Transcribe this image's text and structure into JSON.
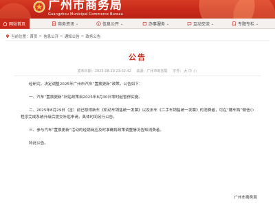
{
  "header": {
    "title": "广州市商务局",
    "subtitle": "Guangzhou Municipal Commerce Bureau"
  },
  "nav": {
    "items": [
      {
        "label": "网站首页",
        "active": true
      },
      {
        "label": "商务资讯"
      },
      {
        "label": "信息公开"
      },
      {
        "label": "办事服务"
      },
      {
        "label": "互动交流"
      },
      {
        "label": "专题专栏"
      }
    ]
  },
  "breadcrumb": {
    "prefix": "当前位置：",
    "items": [
      "首页",
      "信息公开",
      "通知公告",
      "政务公告"
    ],
    "separator": ">"
  },
  "article": {
    "title": "公告",
    "publish_label": "发布日期：",
    "publish_date": "2025-08-29 23:02:42",
    "source_label": "来源：",
    "source": "广州市商务局",
    "font_size_label": "字号：",
    "font_sizes": [
      "大",
      "中",
      "小"
    ],
    "paragraphs": [
      "经研究，决定调整2025年广州市汽车“置换更新”政策，公告如下：",
      "一、汽车“置换更新”补贴政策自2025年8月30日零时起暂停实施。",
      "二、2025年8月29日（含）前已取得新车《机动车销售统一发票》以及旧车《二手车销售统一发票》的消费者，可在“穗车购”微信小程序完成系统升级后提交补贴申请，具体时间另行公告。",
      "三、参与汽车“置换更新”活动的经销商应及时准确将政策调整情况告知消费者。",
      "特此公告。"
    ],
    "signature": "广州市商务局"
  },
  "colors": {
    "brand_red": "#c8291a",
    "nav_bg": "#f4f1ef"
  }
}
